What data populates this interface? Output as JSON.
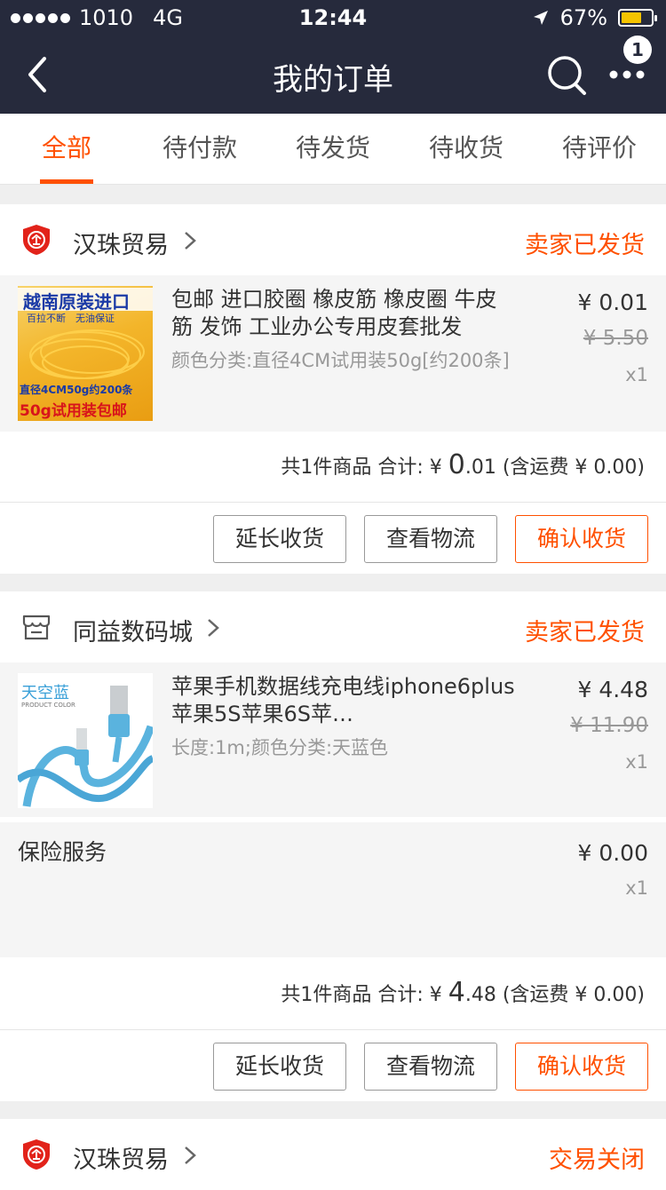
{
  "status_bar": {
    "carrier": "1010",
    "network": "4G",
    "time": "12:44",
    "battery": "67%",
    "battery_level": 0.67
  },
  "nav": {
    "title": "我的订单",
    "badge_count": "1"
  },
  "tabs": [
    {
      "label": "全部"
    },
    {
      "label": "待付款"
    },
    {
      "label": "待发货"
    },
    {
      "label": "待收货"
    },
    {
      "label": "待评价"
    }
  ],
  "orders": [
    {
      "shop_name": "汉珠贸易",
      "shop_icon": "enterprise-shield-icon",
      "status": "卖家已发货",
      "item": {
        "title": "包邮 进口胶圈 橡皮筋 橡皮圈 牛皮筋 发饰 工业办公专用皮套批发",
        "sku": "颜色分类:直径4CM试用装50g[约200条]",
        "price": "¥ 0.01",
        "original_price": "¥ 5.50",
        "qty": "x1",
        "image_text_top": "越南原装进口",
        "image_text_sub": "百拉不断　无油保证",
        "image_text_bottom1": "直径4CM50g约200条",
        "image_text_bottom2": "50g试用装包邮"
      },
      "summary": {
        "count_text": "共1件商品 合计: ¥ ",
        "total_int": "0",
        "total_dec": ".01",
        "shipping": " (含运费 ¥ 0.00)"
      },
      "buttons": {
        "extend": "延长收货",
        "logistics": "查看物流",
        "confirm": "确认收货"
      }
    },
    {
      "shop_name": "同益数码城",
      "shop_icon": "store-icon",
      "status": "卖家已发货",
      "item": {
        "title": "苹果手机数据线充电线iphone6plus苹果5S苹果6S苹…",
        "sku": "长度:1m;颜色分类:天蓝色",
        "price": "¥ 4.48",
        "original_price": "¥ 11.90",
        "qty": "x1",
        "image_text_top": "天空蓝",
        "image_text_sub": "PRODUCT COLOR"
      },
      "insurance": {
        "label": "保险服务",
        "price": "¥ 0.00",
        "qty": "x1"
      },
      "summary": {
        "count_text": "共1件商品 合计: ¥ ",
        "total_int": "4",
        "total_dec": ".48",
        "shipping": " (含运费 ¥ 0.00)"
      },
      "buttons": {
        "extend": "延长收货",
        "logistics": "查看物流",
        "confirm": "确认收货"
      }
    },
    {
      "shop_name": "汉珠贸易",
      "shop_icon": "enterprise-shield-icon",
      "status": "交易关闭"
    }
  ],
  "colors": {
    "header_bg": "#262a3c",
    "accent": "#ff5000",
    "battery": "#f5c400"
  }
}
